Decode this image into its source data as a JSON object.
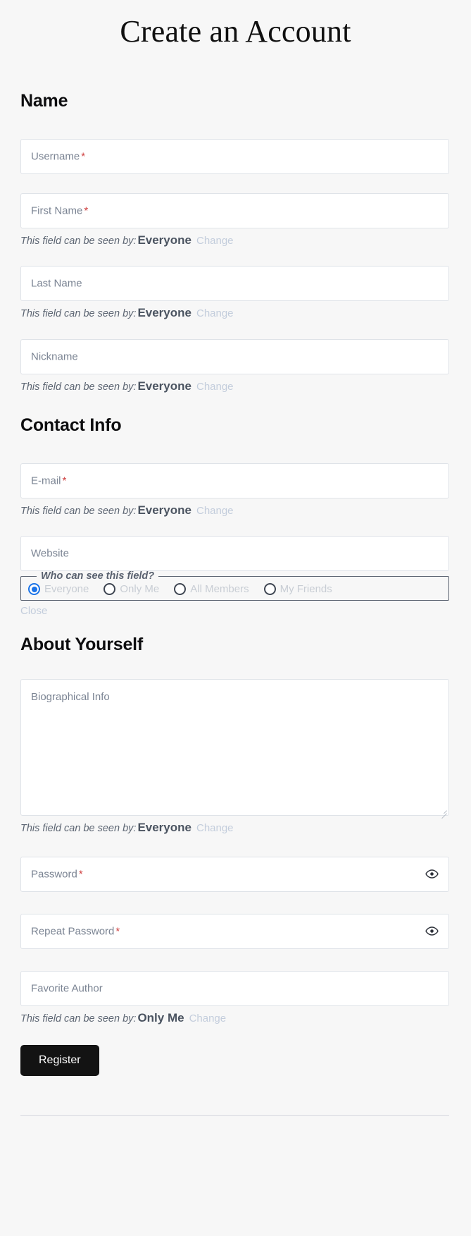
{
  "page": {
    "title": "Create an Account",
    "background_color": "#f7f7f7"
  },
  "colors": {
    "accent_radio": "#1a73e8",
    "required_asterisk": "#cf4040",
    "link": "#c3cddc",
    "button_bg": "#131313",
    "input_border": "#dfe3e8",
    "fieldset_border": "#5a6270"
  },
  "sections": {
    "name": {
      "heading": "Name"
    },
    "contact": {
      "heading": "Contact Info"
    },
    "about": {
      "heading": "About Yourself"
    }
  },
  "labels": {
    "visibility_prefix": "This field can be seen by:",
    "change_link": "Change",
    "close_link": "Close",
    "required_mark": "*"
  },
  "fields": {
    "username": {
      "placeholder": "Username",
      "value": "",
      "required": true
    },
    "first_name": {
      "placeholder": "First Name",
      "value": "",
      "required": true,
      "visibility": "Everyone"
    },
    "last_name": {
      "placeholder": "Last Name",
      "value": "",
      "required": false,
      "visibility": "Everyone"
    },
    "nickname": {
      "placeholder": "Nickname",
      "value": "",
      "required": false,
      "visibility": "Everyone"
    },
    "email": {
      "placeholder": "E-mail",
      "value": "",
      "required": true,
      "visibility": "Everyone"
    },
    "website": {
      "placeholder": "Website",
      "value": "",
      "required": false,
      "visibility": "Everyone"
    },
    "bio": {
      "placeholder": "Biographical Info",
      "value": "",
      "required": false,
      "visibility": "Everyone"
    },
    "password": {
      "placeholder": "Password",
      "value": "",
      "required": true
    },
    "repeat_password": {
      "placeholder": "Repeat Password",
      "value": "",
      "required": true
    },
    "favorite_author": {
      "placeholder": "Favorite Author",
      "value": "",
      "required": false,
      "visibility": "Only Me"
    }
  },
  "visibility_picker": {
    "legend": "Who can see this field?",
    "selected": "Everyone",
    "options": [
      {
        "label": "Everyone",
        "selected": true
      },
      {
        "label": "Only Me",
        "selected": false
      },
      {
        "label": "All Members",
        "selected": false
      },
      {
        "label": "My Friends",
        "selected": false
      }
    ]
  },
  "submit": {
    "label": "Register"
  },
  "icons": {
    "eye": "eye-icon"
  }
}
